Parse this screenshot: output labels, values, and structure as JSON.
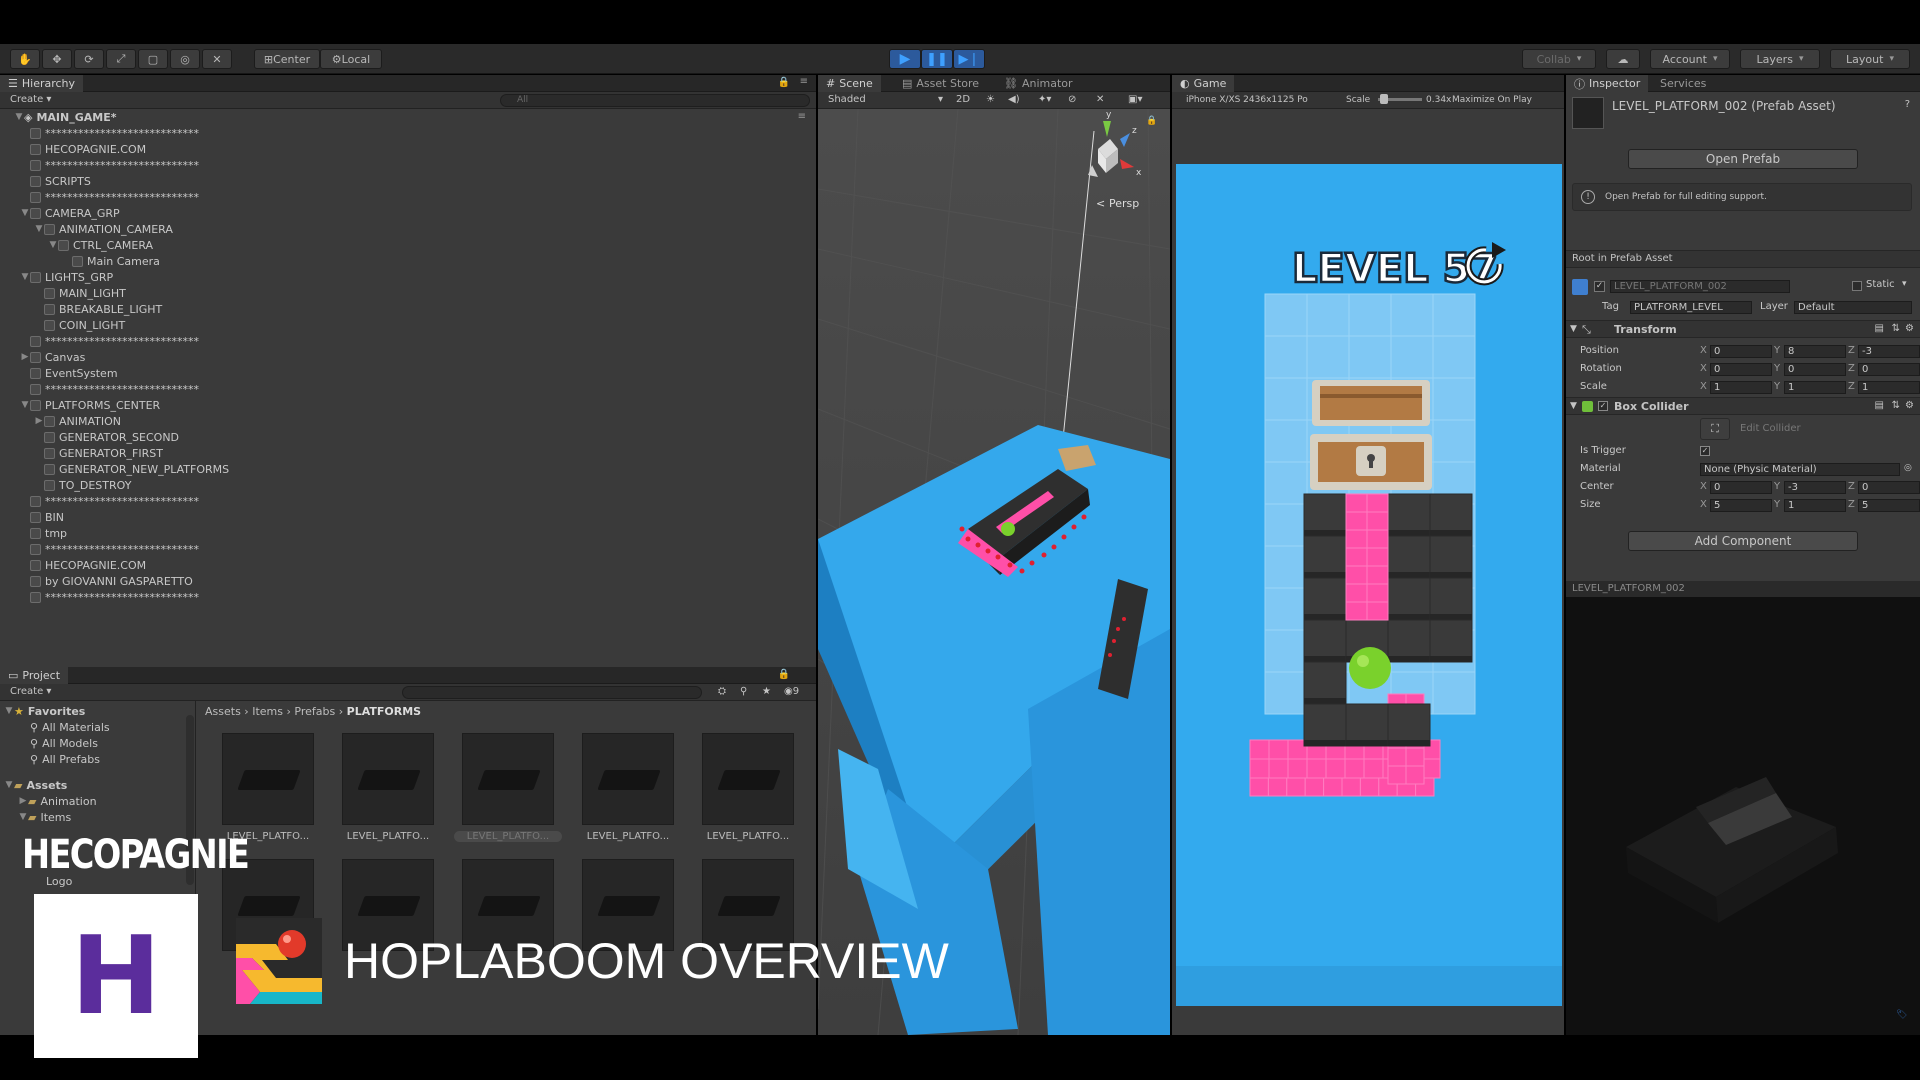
{
  "toolbar": {
    "pivot_center": "Center",
    "pivot_local": "Local",
    "collab": "Collab",
    "account": "Account",
    "layers": "Layers",
    "layout": "Layout"
  },
  "hierarchy": {
    "tab": "Hierarchy",
    "create": "Create",
    "search_placeholder": "All",
    "scene": "MAIN_GAME*",
    "items": [
      {
        "label": "****************************",
        "indent": 2
      },
      {
        "label": "HECOPAGNIE.COM",
        "indent": 2
      },
      {
        "label": "****************************",
        "indent": 2
      },
      {
        "label": "SCRIPTS",
        "indent": 2
      },
      {
        "label": "****************************",
        "indent": 2
      },
      {
        "label": "CAMERA_GRP",
        "indent": 2,
        "expanded": true
      },
      {
        "label": "ANIMATION_CAMERA",
        "indent": 3,
        "expanded": true
      },
      {
        "label": "CTRL_CAMERA",
        "indent": 4,
        "expanded": true
      },
      {
        "label": "Main Camera",
        "indent": 5
      },
      {
        "label": "LIGHTS_GRP",
        "indent": 2,
        "expanded": true
      },
      {
        "label": "MAIN_LIGHT",
        "indent": 3
      },
      {
        "label": "BREAKABLE_LIGHT",
        "indent": 3
      },
      {
        "label": "COIN_LIGHT",
        "indent": 3
      },
      {
        "label": "****************************",
        "indent": 2
      },
      {
        "label": "Canvas",
        "indent": 2,
        "collapsed": true
      },
      {
        "label": "EventSystem",
        "indent": 2
      },
      {
        "label": "****************************",
        "indent": 2
      },
      {
        "label": "PLATFORMS_CENTER",
        "indent": 2,
        "expanded": true
      },
      {
        "label": "ANIMATION",
        "indent": 3,
        "collapsed": true
      },
      {
        "label": "GENERATOR_SECOND",
        "indent": 3
      },
      {
        "label": "GENERATOR_FIRST",
        "indent": 3
      },
      {
        "label": "GENERATOR_NEW_PLATFORMS",
        "indent": 3
      },
      {
        "label": "TO_DESTROY",
        "indent": 3
      },
      {
        "label": "****************************",
        "indent": 2
      },
      {
        "label": "BIN",
        "indent": 2
      },
      {
        "label": "tmp",
        "indent": 2
      },
      {
        "label": "****************************",
        "indent": 2
      },
      {
        "label": "HECOPAGNIE.COM",
        "indent": 2
      },
      {
        "label": "by GIOVANNI GASPARETTO",
        "indent": 2
      },
      {
        "label": "****************************",
        "indent": 2
      }
    ]
  },
  "project": {
    "tab": "Project",
    "create": "Create",
    "favorites": "Favorites",
    "fav_items": [
      "All Materials",
      "All Models",
      "All Prefabs"
    ],
    "assets": "Assets",
    "asset_items": [
      "Animation",
      "Items",
      "Logo"
    ],
    "breadcrumb": [
      "Assets",
      "Items",
      "Prefabs",
      "PLATFORMS"
    ],
    "thumb_label": "LEVEL_PLATFO...",
    "count": "9"
  },
  "scene": {
    "tabs": [
      "Scene",
      "Asset Store",
      "Animator"
    ],
    "shaded": "Shaded",
    "mode_2d": "2D",
    "persp": "Persp",
    "gizmo_y": "y",
    "gizmo_z": "z",
    "gizmo_x": "x"
  },
  "game": {
    "tab": "Game",
    "resolution": "iPhone X/XS 2436x1125 Po",
    "scale_label": "Scale",
    "scale_value": "0.34x",
    "maximize": "Maximize On Play",
    "level_text": "LEVEL 57",
    "restart_icon": "restart-icon"
  },
  "inspector": {
    "tabs": [
      "Inspector",
      "Services"
    ],
    "asset_title": "LEVEL_PLATFORM_002 (Prefab Asset)",
    "open_prefab": "Open Prefab",
    "info_text": "Open Prefab for full editing support.",
    "root_label": "Root in Prefab Asset",
    "object_name": "LEVEL_PLATFORM_002",
    "static_label": "Static",
    "tag_label": "Tag",
    "tag_value": "PLATFORM_LEVEL",
    "layer_label": "Layer",
    "layer_value": "Default",
    "transform": {
      "title": "Transform",
      "rows": [
        {
          "label": "Position",
          "x": "0",
          "y": "8",
          "z": "-3"
        },
        {
          "label": "Rotation",
          "x": "0",
          "y": "0",
          "z": "0"
        },
        {
          "label": "Scale",
          "x": "1",
          "y": "1",
          "z": "1"
        }
      ]
    },
    "box_collider": {
      "title": "Box Collider",
      "edit_collider": "Edit Collider",
      "is_trigger": "Is Trigger",
      "material_label": "Material",
      "material_value": "None (Physic Material)",
      "center_label": "Center",
      "center": {
        "x": "0",
        "y": "-3",
        "z": "0"
      },
      "size_label": "Size",
      "size": {
        "x": "5",
        "y": "1",
        "z": "5"
      }
    },
    "add_component": "Add Component",
    "preview_title": "LEVEL_PLATFORM_002"
  },
  "overlay": {
    "brand": "HECOPAGNIE",
    "logo_letter": "H",
    "title": "HOPLABOOM OVERVIEW"
  },
  "axis_labels": {
    "x": "X",
    "y": "Y",
    "z": "Z"
  },
  "colors": {
    "game_bg": "#33aaee",
    "pink": "#ff4fa8",
    "dark_block": "#3a3a3a",
    "light_tile": "#7fc8f4",
    "logo_purple": "#5b2d9c"
  }
}
